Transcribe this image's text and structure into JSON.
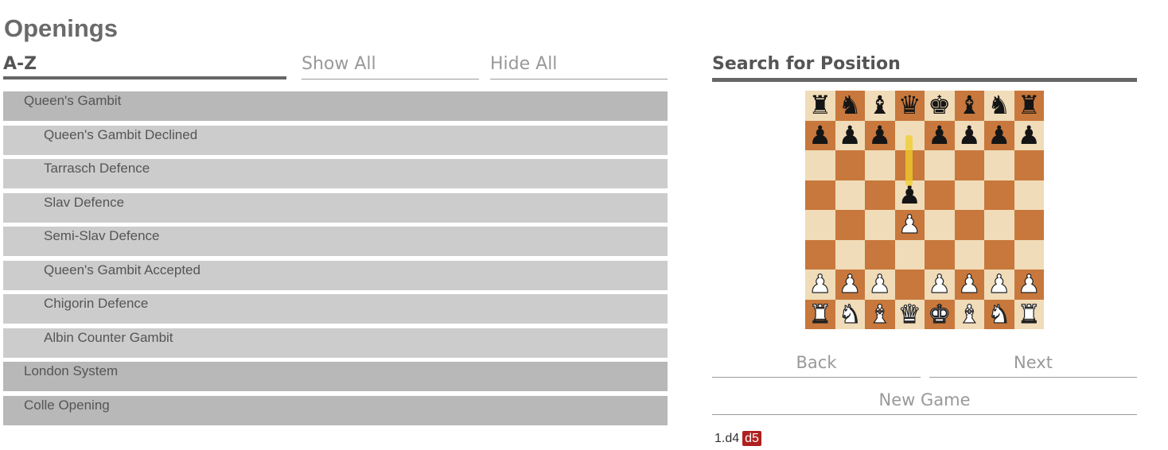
{
  "page": {
    "title": "Openings"
  },
  "tabs": {
    "az": "A-Z",
    "show_all": "Show All",
    "hide_all": "Hide All"
  },
  "openings": [
    {
      "label": "Queen's Gambit",
      "level": 0
    },
    {
      "label": "Queen's Gambit Declined",
      "level": 1
    },
    {
      "label": "Tarrasch Defence",
      "level": 1
    },
    {
      "label": "Slav Defence",
      "level": 1
    },
    {
      "label": "Semi-Slav Defence",
      "level": 1
    },
    {
      "label": "Queen's Gambit Accepted",
      "level": 1
    },
    {
      "label": "Chigorin Defence",
      "level": 1
    },
    {
      "label": "Albin Counter Gambit",
      "level": 1
    },
    {
      "label": "London System",
      "level": 0
    },
    {
      "label": "Colle Opening",
      "level": 0
    }
  ],
  "search": {
    "title": "Search for Position",
    "board": {
      "position": [
        "rnbqkbnr",
        "ppp.pppp",
        "........",
        "...p....",
        "...P....",
        "........",
        "PPP.PPPP",
        "RNBQKBNR"
      ],
      "last_move": {
        "from": "d7",
        "to": "d5"
      },
      "colors": {
        "light": "#f0dcb8",
        "dark": "#c8783c",
        "highlight": "#f0cd28"
      }
    },
    "buttons": {
      "back": "Back",
      "next": "Next",
      "new_game": "New Game"
    },
    "moves": {
      "text": "1.d4",
      "current": "d5",
      "current_color": "#b02020"
    }
  }
}
